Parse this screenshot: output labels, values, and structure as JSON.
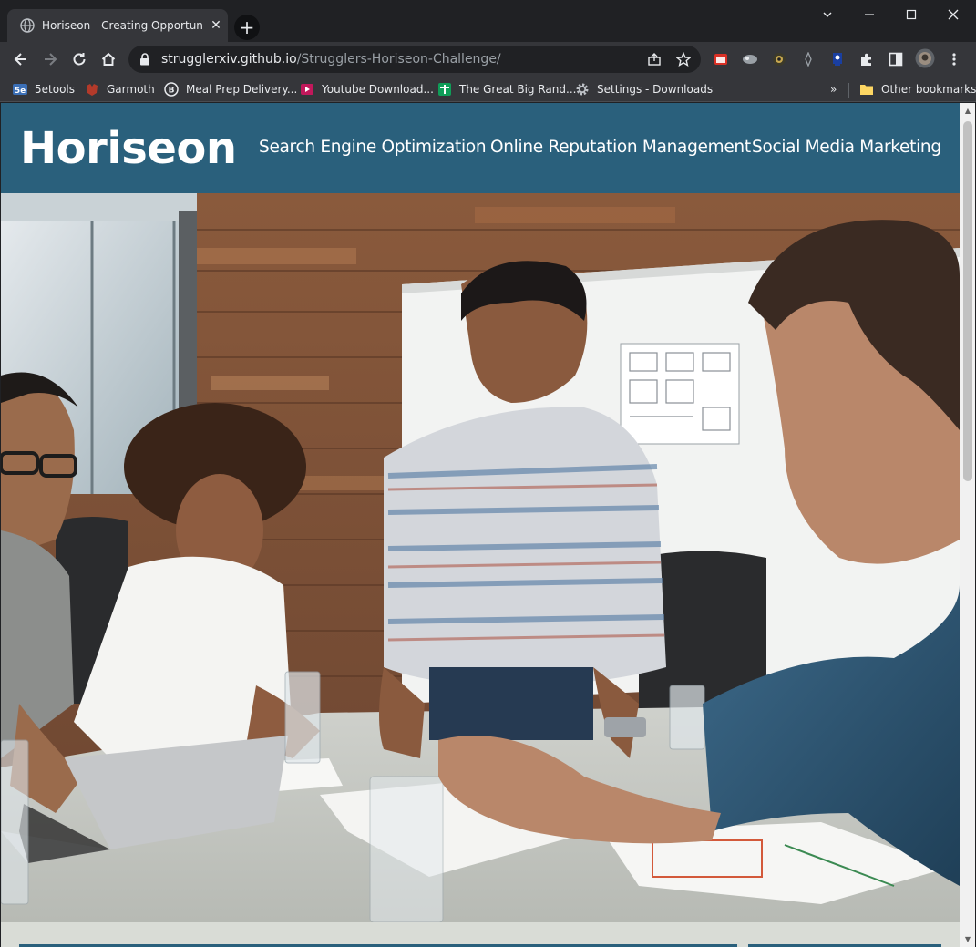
{
  "browser": {
    "tab_title": "Horiseon - Creating Opportunitie",
    "tab_close": "✕",
    "new_tab": "+",
    "url_host": "strugglerxiv.github.io",
    "url_path": "/Strugglers-Horiseon-Challenge/",
    "bookmarks": [
      {
        "label": "5etools",
        "icon": "5etools-icon"
      },
      {
        "label": "Garmoth",
        "icon": "garmoth-icon"
      },
      {
        "label": "Meal Prep Delivery...",
        "icon": "meal-prep-icon"
      },
      {
        "label": "Youtube Download...",
        "icon": "youtube-download-icon"
      },
      {
        "label": "The Great Big Rand...",
        "icon": "sheets-icon"
      },
      {
        "label": "Settings - Downloads",
        "icon": "settings-gear-icon"
      }
    ],
    "overflow": "»",
    "other_bookmarks": "Other bookmarks"
  },
  "site": {
    "logo": "Horiseon",
    "nav": [
      "Search Engine Optimization",
      "Online Reputation Management",
      "Social Media Marketing"
    ],
    "hero_image": "team-meeting-photo",
    "colors": {
      "header_bg": "#2a607c",
      "page_bg": "#d9dcd6"
    }
  }
}
